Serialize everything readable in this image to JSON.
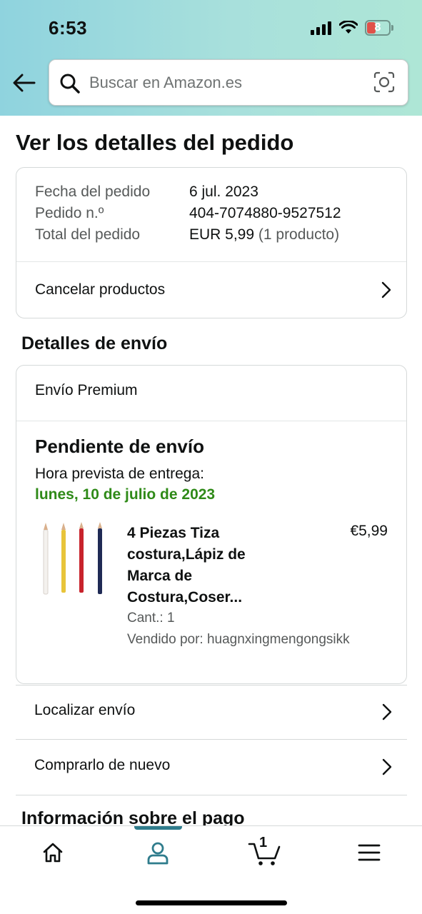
{
  "status_bar": {
    "time": "6:53",
    "battery": "8"
  },
  "header": {
    "search_placeholder": "Buscar en Amazon.es",
    "back_icon": "arrow-left-icon",
    "search_icon": "magnifier-icon",
    "camera_icon": "camera-scan-icon"
  },
  "page": {
    "title": "Ver los detalles del pedido"
  },
  "summary": {
    "rows": [
      {
        "label": "Fecha del pedido",
        "value": "6 jul. 2023"
      },
      {
        "label": "Pedido n.º",
        "value": "404-7074880-9527512"
      },
      {
        "label": "Total del pedido",
        "value": "EUR 5,99",
        "extra": " (1 producto)"
      }
    ],
    "cancel_label": "Cancelar productos"
  },
  "shipping": {
    "section_title": "Detalles de envío",
    "method": "Envío Premium",
    "status": "Pendiente de envío",
    "eta_label": "Hora prevista de entrega:",
    "eta_date": "lunes, 10 de julio de 2023",
    "eta_color": "#2f8a18",
    "product": {
      "name": "4 Piezas Tiza costura,Lápiz de Marca de Costura,Coser...",
      "price": "€5,99",
      "quantity": "Cant.: 1",
      "seller": "Vendido por: huagnxingmengongsikk"
    }
  },
  "actions": {
    "track": "Localizar envío",
    "buy_again": "Comprarlo de nuevo"
  },
  "payment": {
    "section_title": "Información sobre el pago"
  },
  "tabbar": {
    "cart_count": "1",
    "accent": "#2f7c8c",
    "tabs": [
      "home-icon",
      "account-icon",
      "cart-icon",
      "menu-icon"
    ]
  }
}
